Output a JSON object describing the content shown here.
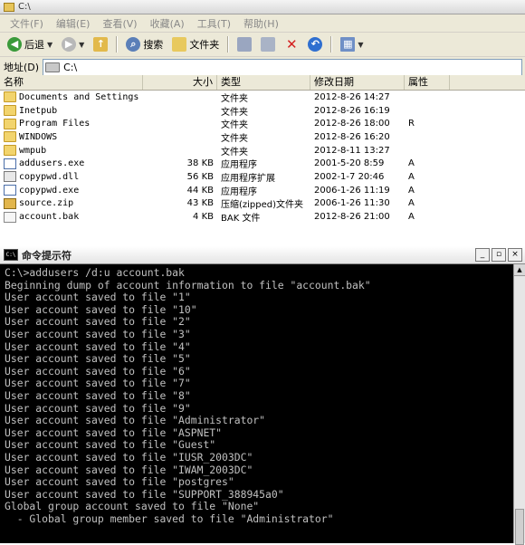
{
  "explorer": {
    "title": "C:\\",
    "menu": [
      "文件(F)",
      "编辑(E)",
      "查看(V)",
      "收藏(A)",
      "工具(T)",
      "帮助(H)"
    ],
    "toolbar": {
      "back_label": "后退",
      "search_label": "搜索",
      "folders_label": "文件夹"
    },
    "address": {
      "label": "地址(D)",
      "value": "C:\\"
    },
    "columns": {
      "name": "名称",
      "size": "大小",
      "type": "类型",
      "date": "修改日期",
      "attr": "属性"
    },
    "files": [
      {
        "name": "Documents and Settings",
        "size": "",
        "type": "文件夹",
        "date": "2012-8-26 14:27",
        "attr": "",
        "icon": "folder"
      },
      {
        "name": "Inetpub",
        "size": "",
        "type": "文件夹",
        "date": "2012-8-26 16:19",
        "attr": "",
        "icon": "folder"
      },
      {
        "name": "Program Files",
        "size": "",
        "type": "文件夹",
        "date": "2012-8-26 18:00",
        "attr": "R",
        "icon": "folder"
      },
      {
        "name": "WINDOWS",
        "size": "",
        "type": "文件夹",
        "date": "2012-8-26 16:20",
        "attr": "",
        "icon": "folder"
      },
      {
        "name": "wmpub",
        "size": "",
        "type": "文件夹",
        "date": "2012-8-11 13:27",
        "attr": "",
        "icon": "folder"
      },
      {
        "name": "addusers.exe",
        "size": "38 KB",
        "type": "应用程序",
        "date": "2001-5-20 8:59",
        "attr": "A",
        "icon": "exe"
      },
      {
        "name": "copypwd.dll",
        "size": "56 KB",
        "type": "应用程序扩展",
        "date": "2002-1-7 20:46",
        "attr": "A",
        "icon": "dll"
      },
      {
        "name": "copypwd.exe",
        "size": "44 KB",
        "type": "应用程序",
        "date": "2006-1-26 11:19",
        "attr": "A",
        "icon": "exe"
      },
      {
        "name": "source.zip",
        "size": "43 KB",
        "type": "压缩(zipped)文件夹",
        "date": "2006-1-26 11:30",
        "attr": "A",
        "icon": "zip"
      },
      {
        "name": "account.bak",
        "size": "4 KB",
        "type": "BAK 文件",
        "date": "2012-8-26 21:00",
        "attr": "A",
        "icon": "bak"
      }
    ]
  },
  "cmd": {
    "title": "命令提示符",
    "buttons": {
      "minimize": "_",
      "restore": "▫",
      "close": "×"
    },
    "lines": [
      "C:\\>addusers /d:u account.bak",
      "Beginning dump of account information to file \"account.bak\"",
      "User account saved to file \"1\"",
      "User account saved to file \"10\"",
      "User account saved to file \"2\"",
      "User account saved to file \"3\"",
      "User account saved to file \"4\"",
      "User account saved to file \"5\"",
      "User account saved to file \"6\"",
      "User account saved to file \"7\"",
      "User account saved to file \"8\"",
      "User account saved to file \"9\"",
      "User account saved to file \"Administrator\"",
      "User account saved to file \"ASPNET\"",
      "User account saved to file \"Guest\"",
      "User account saved to file \"IUSR_2003DC\"",
      "User account saved to file \"IWAM_2003DC\"",
      "User account saved to file \"postgres\"",
      "User account saved to file \"SUPPORT_388945a0\"",
      "Global group account saved to file \"None\"",
      "  - Global group member saved to file \"Administrator\""
    ]
  }
}
